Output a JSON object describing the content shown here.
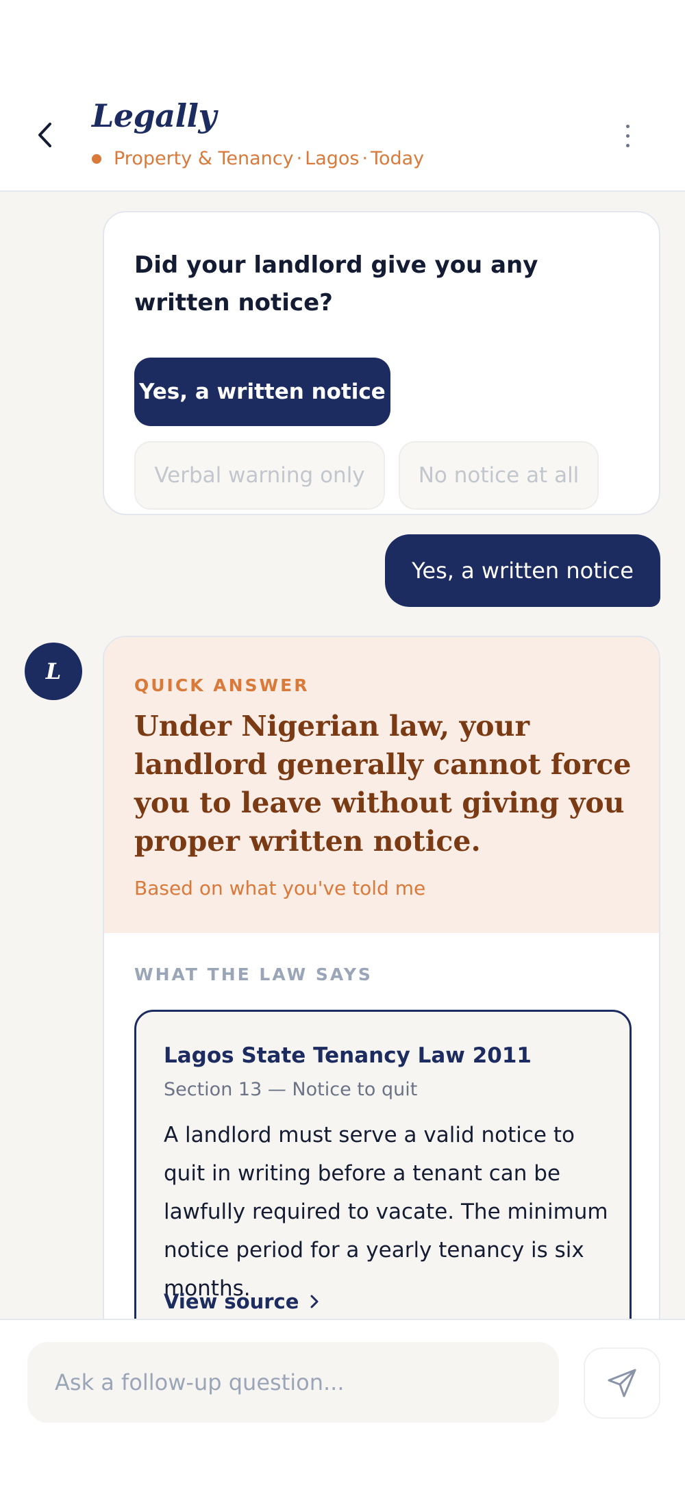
{
  "header": {
    "title": "Legally",
    "category": "Property & Tenancy",
    "location": "Lagos",
    "date": "Today",
    "separator": "·"
  },
  "question": {
    "text": "Did your landlord give you any written notice?",
    "options": [
      {
        "label": "Yes, a written notice",
        "selected": true
      },
      {
        "label": "Verbal warning only",
        "selected": false
      },
      {
        "label": "No notice at all",
        "selected": false
      }
    ]
  },
  "user_reply": "Yes, a written notice",
  "assistant": {
    "avatar_letter": "L",
    "quick_answer_label": "QUICK ANSWER",
    "quick_answer": "Under Nigerian law, your landlord generally cannot force you to leave without giving you proper written notice.",
    "quick_answer_note": "Based on what you've told me",
    "law_label": "WHAT THE LAW SAYS",
    "law": {
      "title": "Lagos State Tenancy Law 2011",
      "section": "Section 13 — Notice to quit",
      "body": "A landlord must serve a valid notice to quit in writing before a tenant can be lawfully required to vacate. The minimum notice period for a yearly tenancy is six months.",
      "link_label": "View source"
    }
  },
  "input": {
    "placeholder": "Ask a follow-up question..."
  },
  "colors": {
    "navy": "#1c2b60",
    "accent": "#d9793a",
    "quick_bg": "#faede5",
    "chat_bg": "#f6f5f2"
  }
}
